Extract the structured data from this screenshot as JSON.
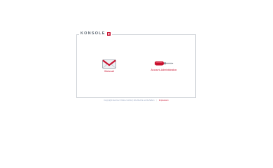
{
  "logo": {
    "text": "KONSOLE"
  },
  "tiles": [
    {
      "label": "Webmail",
      "icon": "envelope-icon"
    },
    {
      "label": "Account-Administration",
      "icon": "screwdriver-icon"
    }
  ],
  "footer": {
    "copyright": "Copyright Hetzner Online GmbH | Alle Rechte vorbehalten",
    "separator": "|",
    "imprint": "Impressum"
  },
  "colors": {
    "accent": "#c8102e",
    "panel_border": "#cfd3d8",
    "footer_text": "#9aa7c2"
  }
}
